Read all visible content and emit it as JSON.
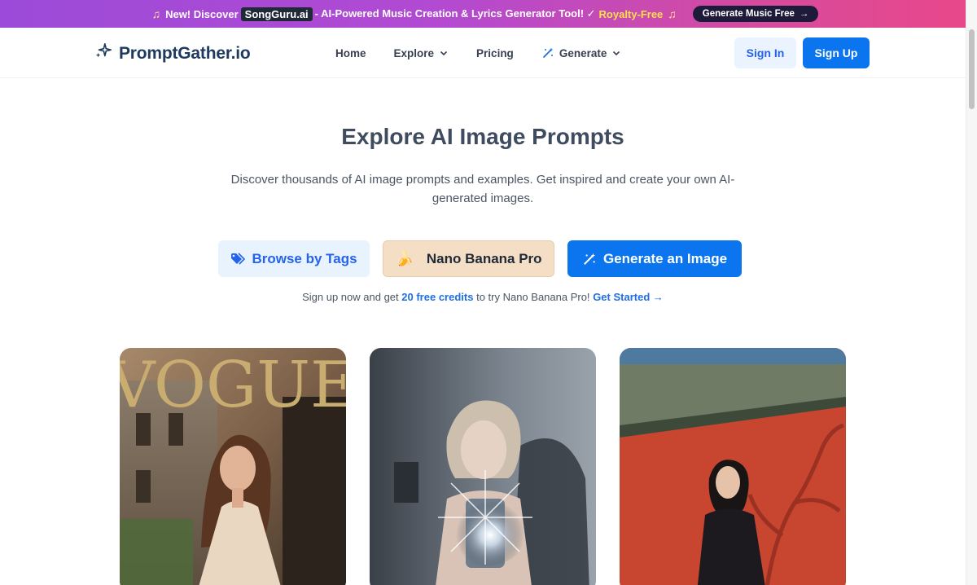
{
  "promo": {
    "note_icon": "music-note-icon",
    "prefix": "New! Discover",
    "brand": "SongGuru.ai",
    "middle": "- AI-Powered Music Creation & Lyrics Generator Tool! ✓",
    "royalty": "Royalty-Free",
    "cta": "Generate Music Free",
    "cta_icon": "arrow-right-icon"
  },
  "nav": {
    "logo": "PromptGather.io",
    "logo_icon": "sparkles-icon",
    "items": [
      {
        "label": "Home"
      },
      {
        "label": "Explore",
        "icon": "chevron-down-icon"
      },
      {
        "label": "Pricing"
      },
      {
        "label": "Generate",
        "icon": "chevron-down-icon",
        "lead_icon": "magic-wand-icon"
      }
    ],
    "sign_in": "Sign In",
    "sign_up": "Sign Up"
  },
  "hero": {
    "title": "Explore AI Image Prompts",
    "subtitle": "Discover thousands of AI image prompts and examples. Get inspired and create your own AI-generated images."
  },
  "actions": {
    "tags": "Browse by Tags",
    "tags_icon": "tags-icon",
    "banana": "Nano Banana Pro",
    "banana_icon": "banana-icon",
    "generate": "Generate an Image",
    "generate_icon": "magic-wand-icon"
  },
  "signup_line": {
    "prefix": "Sign up now and get",
    "credits": "20 free credits",
    "middle": "to try Nano Banana Pro!",
    "link": "Get Started →"
  },
  "cards": [
    {
      "image_text": "VOGUE"
    },
    {
      "image_text": ""
    },
    {
      "image_text": ""
    }
  ],
  "colors": {
    "primary": "#0b74ef",
    "promo_start": "#9b4bd9",
    "promo_end": "#e8488a",
    "title": "#3f4b5e"
  }
}
